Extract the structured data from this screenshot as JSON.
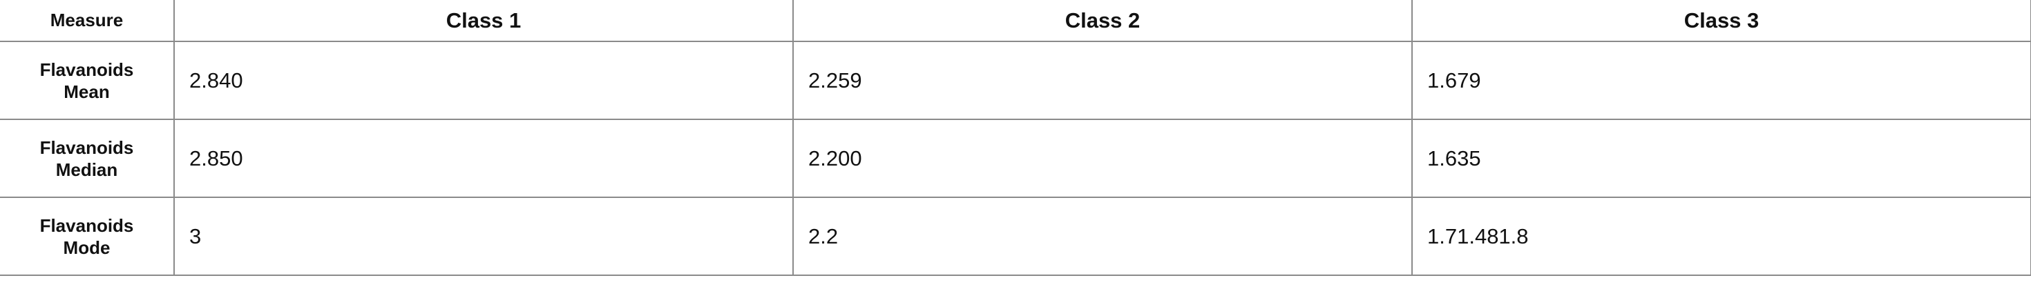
{
  "table": {
    "header": {
      "measure": "Measure",
      "classes": [
        "Class 1",
        "Class 2",
        "Class 3"
      ]
    },
    "rows": [
      {
        "label_line1": "Flavanoids",
        "label_line2": "Mean",
        "values": [
          "2.840",
          "2.259",
          "1.679"
        ]
      },
      {
        "label_line1": "Flavanoids",
        "label_line2": "Median",
        "values": [
          "2.850",
          "2.200",
          "1.635"
        ]
      },
      {
        "label_line1": "Flavanoids",
        "label_line2": "Mode",
        "values": [
          "3",
          "2.2",
          "1.71.481.8"
        ]
      }
    ]
  }
}
